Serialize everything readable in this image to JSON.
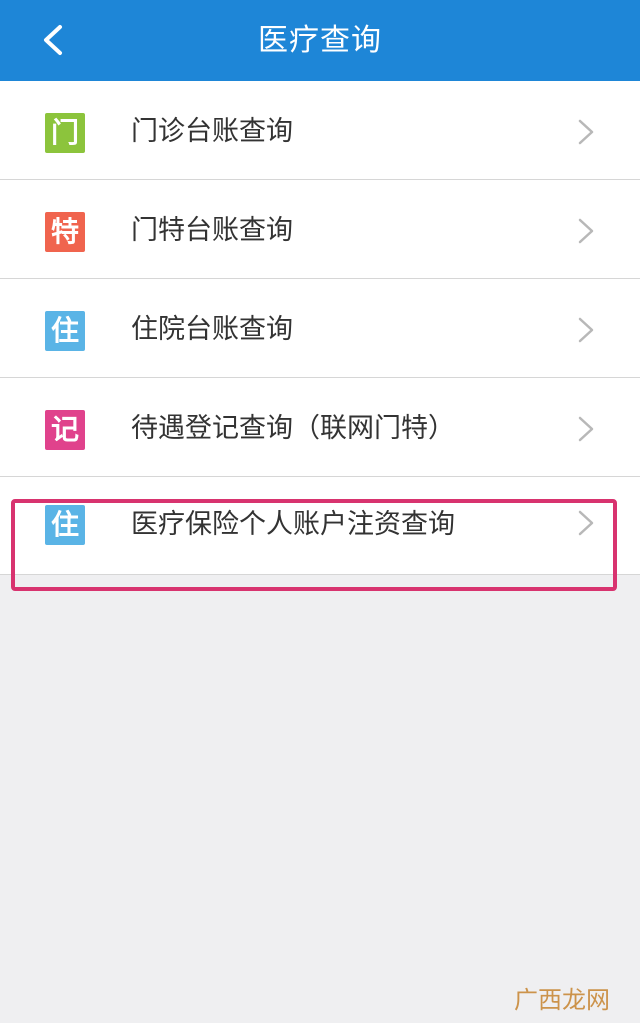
{
  "header": {
    "title": "医疗查询",
    "background": "#1e86d7"
  },
  "menu": {
    "items": [
      {
        "icon_char": "门",
        "icon_color": "#8cc43c",
        "icon_name": "outpatient-icon",
        "label": "门诊台账查询"
      },
      {
        "icon_char": "特",
        "icon_color": "#f0644e",
        "icon_name": "special-outpatient-icon",
        "label": "门特台账查询"
      },
      {
        "icon_char": "住",
        "icon_color": "#5ab4e6",
        "icon_name": "inpatient-icon",
        "label": "住院台账查询"
      },
      {
        "icon_char": "记",
        "icon_color": "#e0428c",
        "icon_name": "registration-icon",
        "label": "待遇登记查询（联网门特）"
      },
      {
        "icon_char": "住",
        "icon_color": "#5ab4e6",
        "icon_name": "insurance-account-icon",
        "label": "医疗保险个人账户注资查询"
      }
    ]
  },
  "annotation": {
    "highlight_color": "#d8336f"
  },
  "watermark": {
    "text": "广西龙网"
  }
}
